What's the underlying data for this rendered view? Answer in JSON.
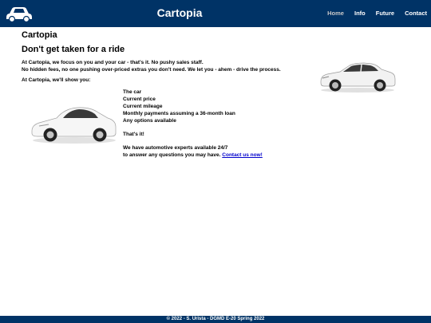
{
  "header": {
    "title": "Cartopia",
    "nav": [
      "Home",
      "Info",
      "Future",
      "Contact"
    ]
  },
  "main": {
    "heading": "Cartopia",
    "subheading": "Don't get taken for a ride",
    "intro_line1": "At Cartopia, we focus on you and your car - that's it. No pushy sales staff.",
    "intro_line2": "No hidden fees, no one pushing over-priced extras you don't need. We let you - ahem - drive the process.",
    "show_label": "At Cartopia, we'll show you:",
    "items": [
      "The car",
      "Current price",
      "Current mileage",
      "Monthly payments assuming a 36-month loan",
      "Any options available"
    ],
    "thats_it": "That's it!",
    "experts_line1": "We have automotive experts available 24/7",
    "experts_line2": "to answer any questions you may have.",
    "contact_link": "Contact us now!"
  },
  "footer": {
    "text": "© 2022 - S. Urista - DGMD E-20 Spring 2022"
  },
  "colors": {
    "header_bg": "#003366",
    "link": "#0000cc"
  },
  "icons": [
    "car-logo-icon"
  ],
  "images": [
    "sedan-car-image",
    "sports-car-image"
  ]
}
